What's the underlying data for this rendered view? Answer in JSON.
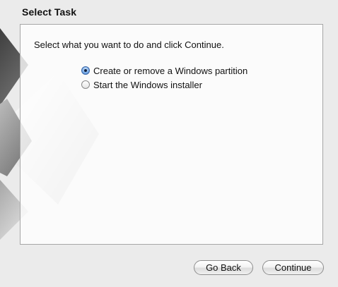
{
  "window": {
    "title": "Select Task"
  },
  "panel": {
    "instructions": "Select what you want to do and click Continue.",
    "options": [
      {
        "label": "Create or remove a Windows partition",
        "selected": true
      },
      {
        "label": "Start the Windows installer",
        "selected": false
      }
    ]
  },
  "buttons": {
    "back_label": "Go Back",
    "continue_label": "Continue"
  },
  "colors": {
    "background": "#ebebeb",
    "panel_border": "#a6a6a6",
    "radio_selected": "#3f7fd0"
  }
}
